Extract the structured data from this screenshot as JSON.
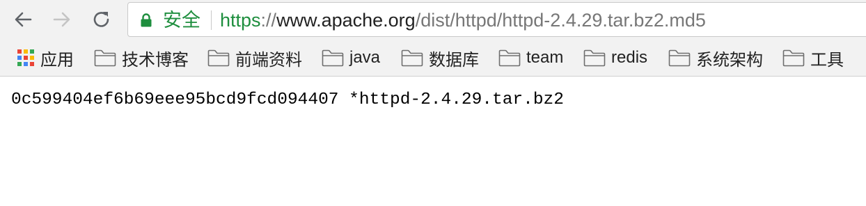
{
  "toolbar": {
    "back_icon": "arrow-left-icon",
    "forward_icon": "arrow-right-icon",
    "reload_icon": "reload-icon"
  },
  "omnibox": {
    "secure_label": "安全",
    "url_scheme": "https",
    "url_separator": "://",
    "url_host": "www.apache.org",
    "url_path": "/dist/httpd/httpd-2.4.29.tar.bz2.md5"
  },
  "bookmarks": {
    "items": [
      {
        "label": "应用",
        "icon": "apps-grid-icon"
      },
      {
        "label": "技术博客",
        "icon": "folder-icon"
      },
      {
        "label": "前端资料",
        "icon": "folder-icon"
      },
      {
        "label": "java",
        "icon": "folder-icon"
      },
      {
        "label": "数据库",
        "icon": "folder-icon"
      },
      {
        "label": "team",
        "icon": "folder-icon"
      },
      {
        "label": "redis",
        "icon": "folder-icon"
      },
      {
        "label": "系统架构",
        "icon": "folder-icon"
      },
      {
        "label": "工具",
        "icon": "folder-icon"
      }
    ]
  },
  "page": {
    "text": "0c599404ef6b69eee95bcd9fcd094407 *httpd-2.4.29.tar.bz2"
  },
  "colors": {
    "secure_green": "#1e8e3e",
    "toolbar_bg": "#f2f2f2",
    "url_dim": "#777777"
  }
}
